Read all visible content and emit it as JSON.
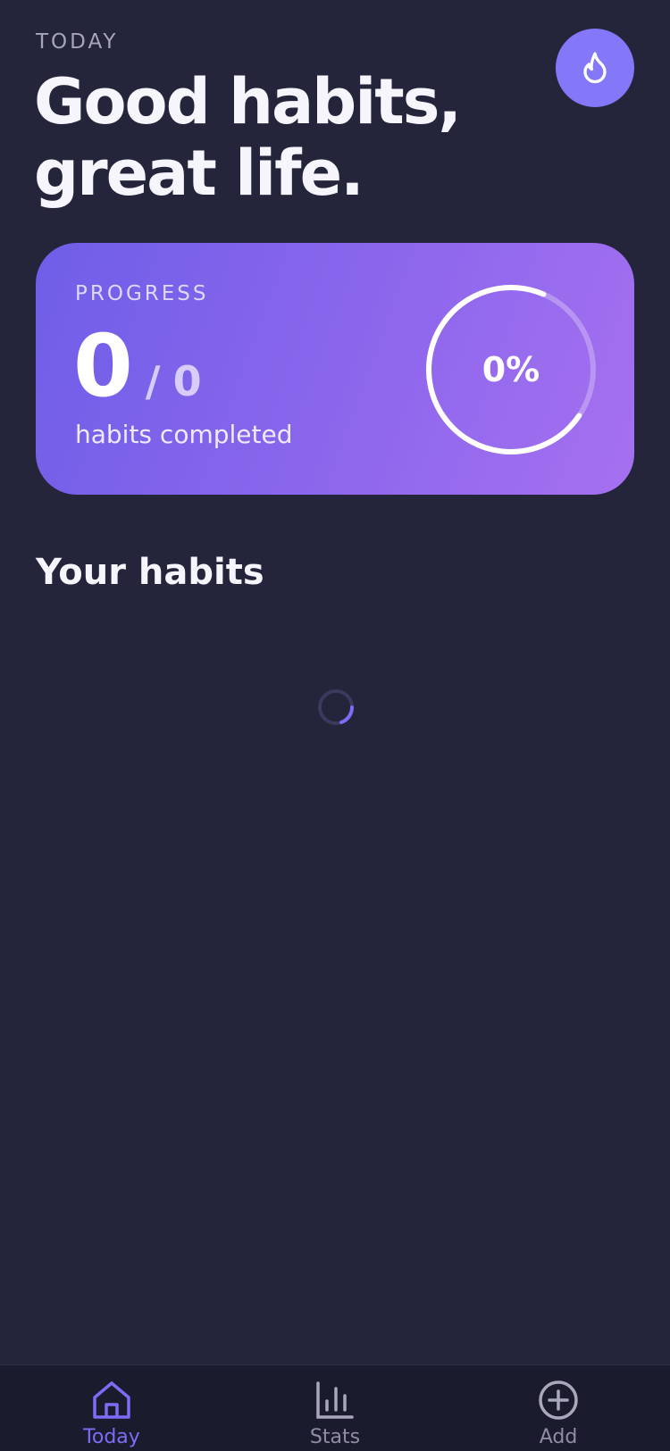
{
  "header": {
    "eyebrow": "TODAY",
    "title": "Good habits, great life.",
    "streak_icon": "flame-icon"
  },
  "progress": {
    "label": "PROGRESS",
    "completed": "0",
    "separator": "/",
    "total": "0",
    "caption": "habits completed",
    "percent_text": "0%",
    "ring_fill_fraction": 0.72
  },
  "habits": {
    "section_title": "Your habits",
    "loading": true
  },
  "tabs": [
    {
      "label": "Today",
      "icon": "home-icon",
      "active": true
    },
    {
      "label": "Stats",
      "icon": "bar-chart-icon",
      "active": false
    },
    {
      "label": "Add",
      "icon": "plus-circle-icon",
      "active": false
    }
  ],
  "colors": {
    "background": "#24253b",
    "accent": "#8478f8",
    "card_gradient_start": "#6f5ee8",
    "card_gradient_end": "#a670f0",
    "tab_bar": "#1b1b2e",
    "tab_active": "#7c6cf6",
    "tab_inactive": "#8e8da5"
  }
}
